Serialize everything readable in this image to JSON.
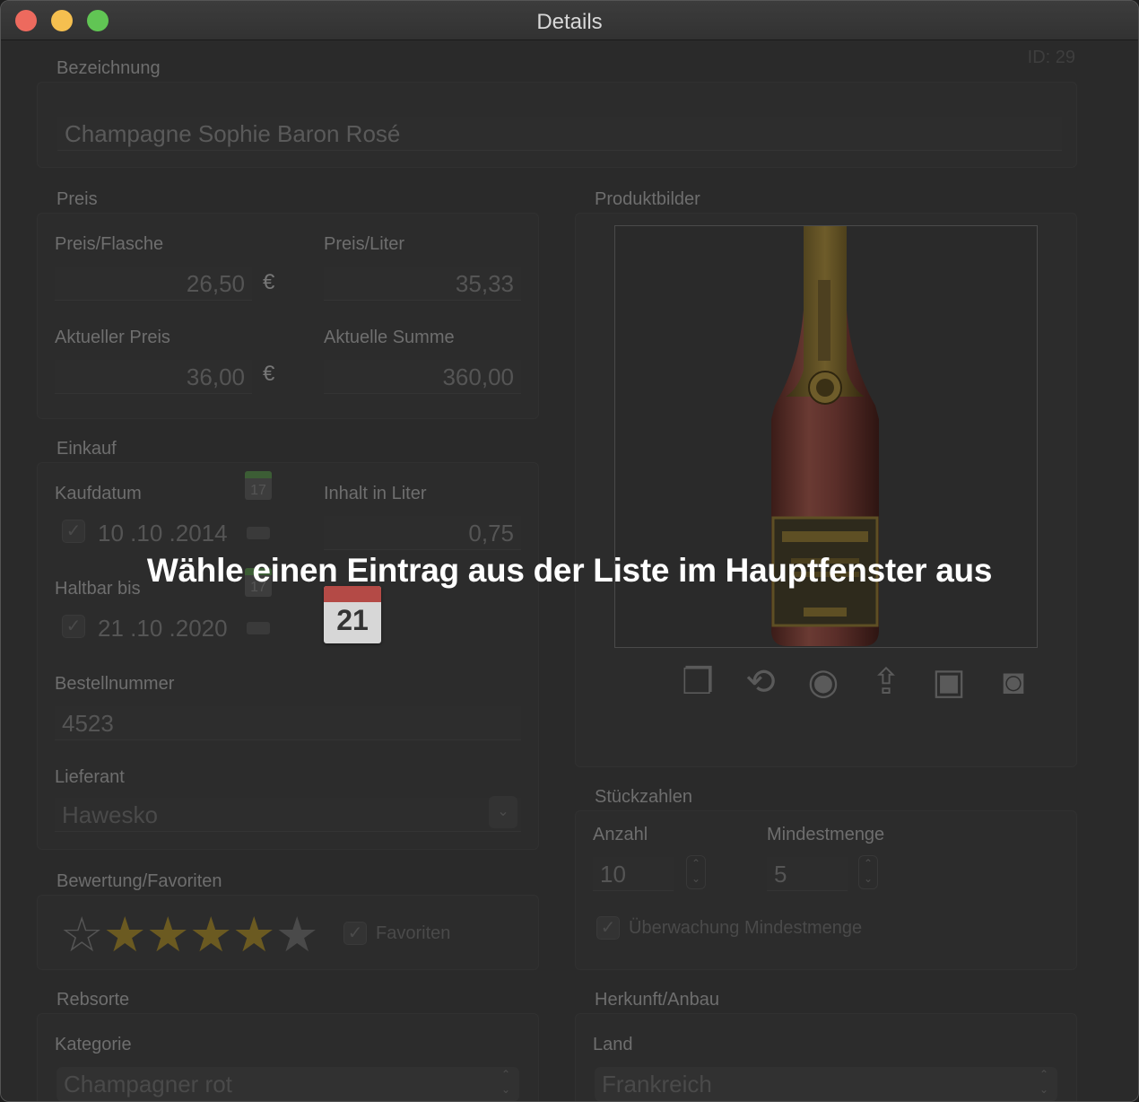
{
  "window": {
    "title": "Details"
  },
  "id_label": "ID: 29",
  "bezeichnung": {
    "label": "Bezeichnung",
    "value": "Champagne Sophie Baron Rosé"
  },
  "preis": {
    "label": "Preis",
    "preis_flasche_label": "Preis/Flasche",
    "preis_flasche_value": "26,50",
    "preis_liter_label": "Preis/Liter",
    "preis_liter_value": "35,33",
    "aktueller_preis_label": "Aktueller Preis",
    "aktueller_preis_value": "36,00",
    "aktuelle_summe_label": "Aktuelle Summe",
    "aktuelle_summe_value": "360,00",
    "currency": "€"
  },
  "einkauf": {
    "label": "Einkauf",
    "kaufdatum_label": "Kaufdatum",
    "kaufdatum_value": "10 .10 .2014",
    "inhalt_label": "Inhalt in Liter",
    "inhalt_value": "0,75",
    "haltbar_label": "Haltbar bis",
    "haltbar_value": "21 .10 .2020",
    "bestellnummer_label": "Bestellnummer",
    "bestellnummer_value": "4523",
    "lieferant_label": "Lieferant",
    "lieferant_value": "Hawesko",
    "calendar_small_day": "17",
    "calendar_big_day": "21"
  },
  "bewertung": {
    "label": "Bewertung/Favoriten",
    "rating": 4,
    "max_rating": 5,
    "favoriten_label": "Favoriten",
    "favoriten_checked": true
  },
  "rebsorte": {
    "label": "Rebsorte",
    "kategorie_label": "Kategorie",
    "kategorie_value": "Champagner rot"
  },
  "produktbilder": {
    "label": "Produktbilder",
    "tool_icons": [
      "photos-icon",
      "flip-icon",
      "eye-icon",
      "share-icon",
      "image-capture-icon",
      "camera-icon"
    ]
  },
  "stueckzahlen": {
    "label": "Stückzahlen",
    "anzahl_label": "Anzahl",
    "anzahl_value": "10",
    "mindestmenge_label": "Mindestmenge",
    "mindestmenge_value": "5",
    "ueberwachung_label": "Überwachung Mindestmenge",
    "ueberwachung_checked": true
  },
  "herkunft": {
    "label": "Herkunft/Anbau",
    "land_label": "Land",
    "land_value": "Frankreich"
  },
  "overlay": {
    "message": "Wähle einen Eintrag aus der Liste im Hauptfenster aus"
  },
  "colors": {
    "accent_gold": "#6b5a21",
    "overlay_text": "#ffffff",
    "background": "#2a2a2a"
  }
}
